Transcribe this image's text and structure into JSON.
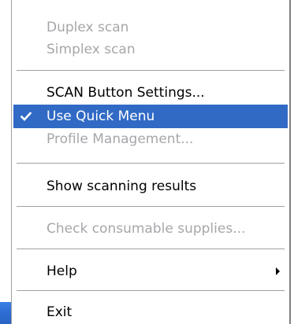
{
  "menu": {
    "items": [
      {
        "label": "Duplex scan",
        "enabled": false
      },
      {
        "label": "Simplex scan",
        "enabled": false
      },
      {
        "label": "SCAN Button Settings...",
        "enabled": true
      },
      {
        "label": "Use Quick Menu",
        "enabled": true,
        "checked": true,
        "highlighted": true
      },
      {
        "label": "Profile Management...",
        "enabled": false
      },
      {
        "label": "Show scanning results",
        "enabled": true
      },
      {
        "label": "Check consumable supplies...",
        "enabled": false
      },
      {
        "label": "Help",
        "enabled": true,
        "submenu": true
      },
      {
        "label": "Exit",
        "enabled": true
      }
    ],
    "icons": {
      "checked": "check-icon",
      "submenu": "submenu-arrow-icon"
    },
    "colors": {
      "highlight": "#316ac5",
      "disabled_text": "#a7a6aa",
      "text": "#000000"
    }
  }
}
